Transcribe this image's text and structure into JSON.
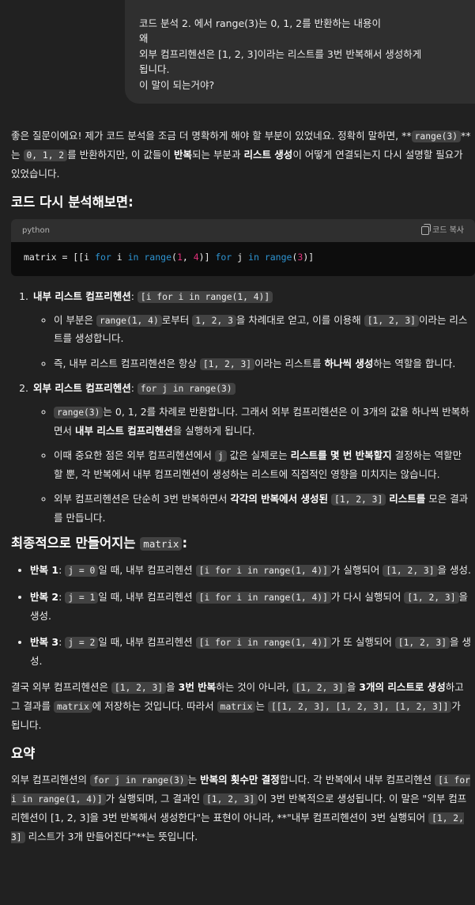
{
  "user_message": {
    "lines": [
      "코드 분석 2. 에서 range(3)는 0, 1, 2를 반환하는 내용이",
      "왜",
      "외부 컴프리헨션은 [1, 2, 3]이라는 리스트를 3번 반복해서 생성하게",
      "됩니다.",
      "이 말이 되는거야?"
    ]
  },
  "intro": {
    "p1": "좋은 질문이에요! 제가 코드 분석을 조금 더 명확하게 해야 할 부분이 있었네요. 정확히 말하면,",
    "stars": "**",
    "code_range3": "range(3)",
    "stars2": "**는",
    "code_012": "0, 1, 2",
    "p2a": "를 반환하지만, 이 값들이 ",
    "bold_repeat": "반복",
    "p2b": "되는 부분과 ",
    "bold_make": "리스트 생성",
    "p2c": "이 어떻게 연결되는지 다시 설명할 필요가 있었습니다."
  },
  "heading_reanalysis": "코드 다시 분석해보면:",
  "code_block": {
    "language": "python",
    "copy_label": "코드 복사",
    "t1": "matrix = [[i ",
    "kw_for": "for",
    "t2": " i ",
    "kw_in": "in",
    "t3": " ",
    "fn_range": "range",
    "t4": "(",
    "n1": "1",
    "t5": ", ",
    "n4": "4",
    "t6": ")] ",
    "kw_for2": "for",
    "t7": " j ",
    "kw_in2": "in",
    "t8": " ",
    "fn_range2": "range",
    "t9": "(",
    "n3": "3",
    "t10": ")]"
  },
  "list1": {
    "title": "내부 리스트 컴프리헨션",
    "colon": ":",
    "code": "[i for i in range(1, 4)]",
    "b1": {
      "a": "이 부분은 ",
      "c1": "range(1, 4)",
      "b": "로부터 ",
      "c2": "1, 2, 3",
      "c": "을 차례대로 얻고, 이를 이용해 ",
      "c3": "[1, 2, 3]",
      "d": "이라는 리스트를 생성합니다."
    },
    "b2": {
      "a": "즉, 내부 리스트 컴프리헨션은 항상 ",
      "c1": "[1, 2, 3]",
      "b": "이라는 리스트를 ",
      "bold": "하나씩 생성",
      "c": "하는 역할을 합니다."
    }
  },
  "list2": {
    "title": "외부 리스트 컴프리헨션",
    "colon": ":",
    "code": "for j in range(3)",
    "b1": {
      "c1": "range(3)",
      "a": "는 0, 1, 2를 차례로 반환합니다. 그래서 외부 컴프리헨션은 이 3개의 값을 하나씩 반복하면서 ",
      "bold": "내부 리스트 컴프리헨션",
      "b": "을 실행하게 됩니다."
    },
    "b2": {
      "a": "이때 중요한 점은 외부 컴프리헨션에서 ",
      "c1": "j",
      "b": " 값은 실제로는 ",
      "bold": "리스트를 몇 번 반복할지",
      "c": " 결정하는 역할만 할 뿐, 각 반복에서 내부 컴프리헨션이 생성하는 리스트에 직접적인 영향을 미치지는 않습니다."
    },
    "b3": {
      "a": "외부 컴프리헨션은 단순히 3번 반복하면서 ",
      "bold": "각각의 반복에서 생성된",
      "c1": "[1, 2, 3]",
      "bold2": "리스트를",
      "b": " 모은 결과를 만듭니다."
    }
  },
  "heading_final": {
    "text": "최종적으로 만들어지는 ",
    "code": "matrix",
    "colon": ":"
  },
  "iterations": [
    {
      "bold": "반복 1",
      "colon": ": ",
      "c1": "j = 0",
      "a": "일 때, 내부 컴프리헨션 ",
      "c2": "[i for i in range(1, 4)]",
      "b": "가 실행되어 ",
      "c3": "[1, 2, 3]",
      "c": "을 생성."
    },
    {
      "bold": "반복 2",
      "colon": ": ",
      "c1": "j = 1",
      "a": "일 때, 내부 컴프리헨션 ",
      "c2": "[i for i in range(1, 4)]",
      "b": "가 다시 실행되어 ",
      "c3": "[1, 2, 3]",
      "c": "을 생성."
    },
    {
      "bold": "반복 3",
      "colon": ": ",
      "c1": "j = 2",
      "a": "일 때, 내부 컴프리헨션 ",
      "c2": "[i for i in range(1, 4)]",
      "b": "가 또 실행되어 ",
      "c3": "[1, 2, 3]",
      "c": "을 생성."
    }
  ],
  "conclusion": {
    "a": "결국 외부 컴프리헨션은 ",
    "c1": "[1, 2, 3]",
    "b": "을 ",
    "bold1": "3번 반복",
    "c": "하는 것이 아니라, ",
    "c2": "[1, 2, 3]",
    "d": "을 ",
    "bold2": "3개의 리스트로 생성",
    "e": "하고 그 결과를 ",
    "c3": "matrix",
    "f": "에 저장하는 것입니다. 따라서 ",
    "c4": "matrix",
    "g": "는 ",
    "c5": "[[1, 2, 3], [1, 2, 3], [1, 2, 3]]",
    "h": "가 됩니다."
  },
  "heading_summary": "요약",
  "summary": {
    "a": "외부 컴프리헨션의 ",
    "c1": "for j in range(3)",
    "b": "는 ",
    "bold1": "반복의 횟수만 결정",
    "c": "합니다. 각 반복에서 내부 컴프리헨션 ",
    "c2": "[i for i in range(1, 4)]",
    "d": "가 실행되며, 그 결과인 ",
    "c3": "[1, 2, 3]",
    "e": "이 3번 반복적으로 생성됩니다. 이 말은 \"외부 컴프리헨션이 [1, 2, 3]을 3번 반복해서 생성한다\"는 표현이 아니라, **\"내부 컴프리헨션이 3번 실행되어 ",
    "c4": "[1, 2, 3]",
    "f": " 리스트가 3개 만들어진다\"**는 뜻입니다."
  }
}
